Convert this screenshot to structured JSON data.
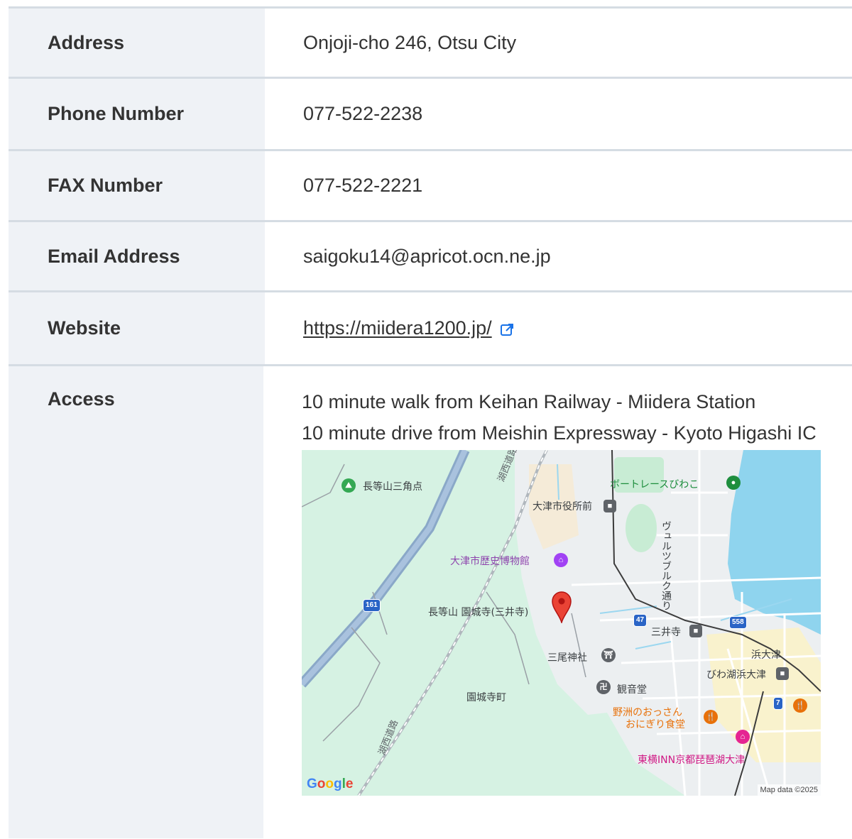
{
  "rows": {
    "address": {
      "label": "Address",
      "value": "Onjoji-cho 246, Otsu City"
    },
    "phone": {
      "label": "Phone Number",
      "value": "077-522-2238"
    },
    "fax": {
      "label": "FAX Number",
      "value": "077-522-2221"
    },
    "email": {
      "label": "Email Address",
      "value": "saigoku14@apricot.ocn.ne.jp"
    },
    "website": {
      "label": "Website",
      "value": "https://miidera1200.jp/",
      "icon": "external-link-icon"
    },
    "access": {
      "label": "Access",
      "lines": [
        "10 minute walk from Keihan Railway - Miidera Station",
        "10 minute drive from Meishin Expressway - Kyoto Higashi IC"
      ]
    }
  },
  "map": {
    "labels": {
      "mountain_point": "長等山三角点",
      "boat_race": "ボートレースびわこ",
      "city_hall_station": "大津市役所前",
      "street": "ヴュルツブルク通り",
      "museum": "大津市歴史博物館",
      "temple": "長等山 園城寺(三井寺)",
      "road_47": "47",
      "road_558": "558",
      "road_161": "161",
      "road_7": "7",
      "miidera_station": "三井寺",
      "shrine": "三尾神社",
      "hamaotsu": "浜大津",
      "biwako_hamaotsu": "びわ湖浜大津",
      "kannondo": "観音堂",
      "town": "園城寺町",
      "restaurant_1": "野洲のおっさん",
      "restaurant_2": "おにぎり食堂",
      "hotel": "東横INN京都琵琶湖大津",
      "expressway_1": "湖西道路",
      "expressway_2": "湖西道路"
    },
    "logo": "Google",
    "attribution": "Map data ©2025",
    "colors": {
      "park": "#d6f2e3",
      "water": "#8fd4ee",
      "urban": "#eceff1",
      "pin": "#ea4335"
    }
  }
}
